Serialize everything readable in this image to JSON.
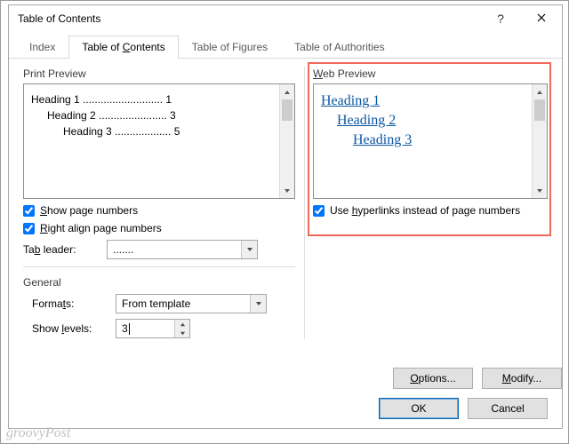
{
  "dialog": {
    "title": "Table of Contents"
  },
  "tabs": {
    "index": "Index",
    "toc_prefix": "Table of ",
    "toc_u": "C",
    "toc_suffix": "ontents",
    "figures": "Table of Figures",
    "auth": "Table of Authorities"
  },
  "printPreview": {
    "label": "Print Preview",
    "h1": "Heading 1 ........................... 1",
    "h2": "Heading 2 ....................... 3",
    "h3": "Heading 3 ................... 5"
  },
  "webPreview": {
    "label_u": "W",
    "label_rest": "eb Preview",
    "h1": "Heading 1",
    "h2": "Heading 2",
    "h3": "Heading 3"
  },
  "options": {
    "showPage_u": "S",
    "showPage_rest": "how page numbers",
    "rightAlign_u": "R",
    "rightAlign_rest": "ight align page numbers",
    "hyperlinks_prefix": "Use ",
    "hyperlinks_u": "h",
    "hyperlinks_rest": "yperlinks instead of page numbers",
    "tabLeader_prefix": "Ta",
    "tabLeader_u": "b",
    "tabLeader_rest": " leader:",
    "tabLeaderValue": ".......",
    "generalLabel": "General",
    "formats_prefix": "Forma",
    "formats_u": "t",
    "formats_rest": "s:",
    "formatsValue": "From template",
    "showLevels_prefix": "Show ",
    "showLevels_u": "l",
    "showLevels_rest": "evels:",
    "showLevelsValue": "3"
  },
  "buttons": {
    "options_u": "O",
    "options_rest": "ptions...",
    "modify_u": "M",
    "modify_rest": "odify...",
    "ok": "OK",
    "cancel": "Cancel"
  },
  "watermark": "groovyPost"
}
